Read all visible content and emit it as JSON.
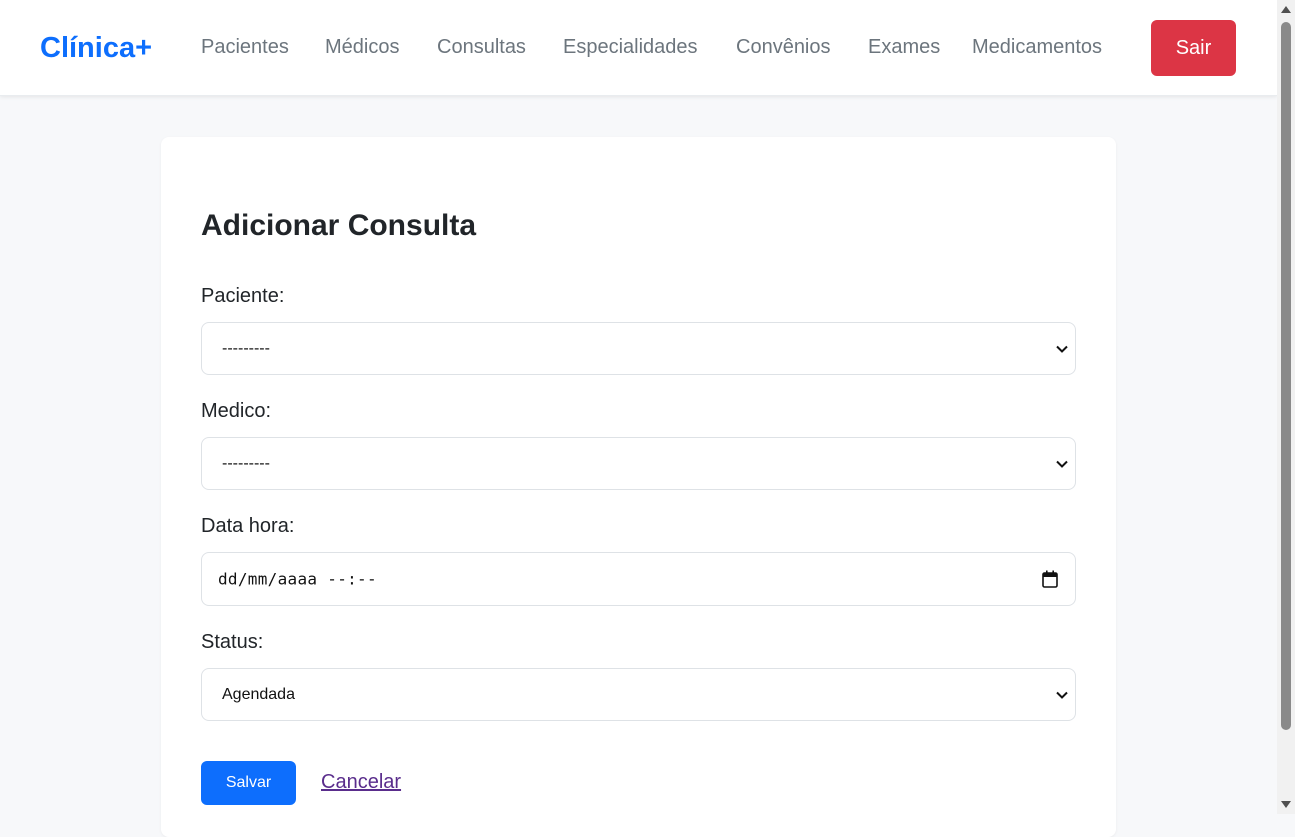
{
  "nav": {
    "brand": "Clínica+",
    "links": [
      "Pacientes",
      "Médicos",
      "Consultas",
      "Especialidades",
      "Convênios",
      "Exames",
      "Medicamentos"
    ],
    "logout": "Sair"
  },
  "form": {
    "title": "Adicionar Consulta",
    "fields": [
      {
        "label": "Paciente:",
        "value": "---------"
      },
      {
        "label": "Medico:",
        "value": "---------"
      },
      {
        "label": "Data hora:",
        "value": "dd/mm/aaaa --:--"
      },
      {
        "label": "Status:",
        "value": "Agendada"
      }
    ],
    "save": "Salvar",
    "cancel": "Cancelar"
  },
  "colors": {
    "brand": "#0d6efd",
    "danger": "#dc3545",
    "primary": "#0d6efd",
    "link_visited": "#5a2d8c"
  }
}
